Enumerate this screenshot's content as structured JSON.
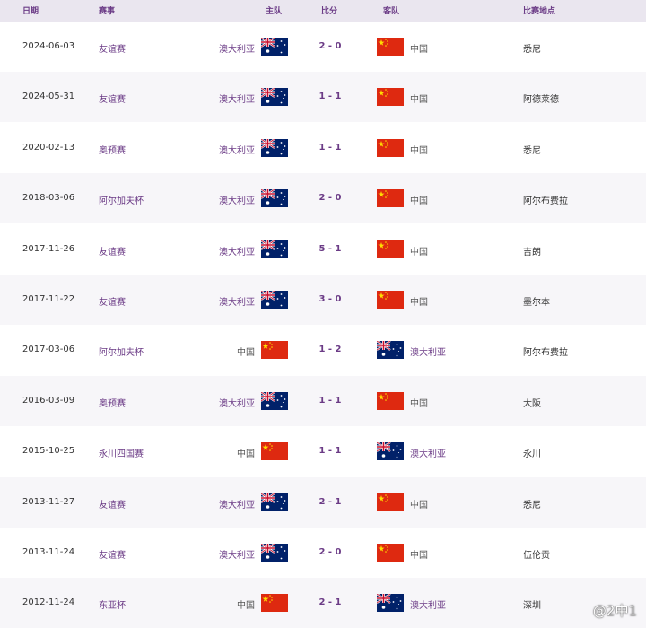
{
  "header": {
    "date": "日期",
    "competition": "赛事",
    "home": "主队",
    "score": "比分",
    "away": "客队",
    "venue": "比赛地点"
  },
  "flags": {
    "australia": "australia-flag-icon",
    "china": "china-flag-icon"
  },
  "colors": {
    "accent": "#6b3b86",
    "header_bg": "#eae6ef",
    "china_red": "#de2910",
    "china_star": "#ffde00",
    "aus_blue": "#012169"
  },
  "matches": [
    {
      "date": "2024-06-03",
      "competition": "友谊赛",
      "home": "澳大利亚",
      "home_team": "australia",
      "score": "2 - 0",
      "away": "中国",
      "away_team": "china",
      "venue": "悉尼"
    },
    {
      "date": "2024-05-31",
      "competition": "友谊赛",
      "home": "澳大利亚",
      "home_team": "australia",
      "score": "1 - 1",
      "away": "中国",
      "away_team": "china",
      "venue": "阿德莱德"
    },
    {
      "date": "2020-02-13",
      "competition": "奥预赛",
      "home": "澳大利亚",
      "home_team": "australia",
      "score": "1 - 1",
      "away": "中国",
      "away_team": "china",
      "venue": "悉尼"
    },
    {
      "date": "2018-03-06",
      "competition": "阿尔加夫杯",
      "home": "澳大利亚",
      "home_team": "australia",
      "score": "2 - 0",
      "away": "中国",
      "away_team": "china",
      "venue": "阿尔布费拉"
    },
    {
      "date": "2017-11-26",
      "competition": "友谊赛",
      "home": "澳大利亚",
      "home_team": "australia",
      "score": "5 - 1",
      "away": "中国",
      "away_team": "china",
      "venue": "吉朗"
    },
    {
      "date": "2017-11-22",
      "competition": "友谊赛",
      "home": "澳大利亚",
      "home_team": "australia",
      "score": "3 - 0",
      "away": "中国",
      "away_team": "china",
      "venue": "墨尔本"
    },
    {
      "date": "2017-03-06",
      "competition": "阿尔加夫杯",
      "home": "中国",
      "home_team": "china",
      "score": "1 - 2",
      "away": "澳大利亚",
      "away_team": "australia",
      "venue": "阿尔布费拉"
    },
    {
      "date": "2016-03-09",
      "competition": "奥预赛",
      "home": "澳大利亚",
      "home_team": "australia",
      "score": "1 - 1",
      "away": "中国",
      "away_team": "china",
      "venue": "大阪"
    },
    {
      "date": "2015-10-25",
      "competition": "永川四国赛",
      "home": "中国",
      "home_team": "china",
      "score": "1 - 1",
      "away": "澳大利亚",
      "away_team": "australia",
      "venue": "永川"
    },
    {
      "date": "2013-11-27",
      "competition": "友谊赛",
      "home": "澳大利亚",
      "home_team": "australia",
      "score": "2 - 1",
      "away": "中国",
      "away_team": "china",
      "venue": "悉尼"
    },
    {
      "date": "2013-11-24",
      "competition": "友谊赛",
      "home": "澳大利亚",
      "home_team": "australia",
      "score": "2 - 0",
      "away": "中国",
      "away_team": "china",
      "venue": "伍伦贡"
    },
    {
      "date": "2012-11-24",
      "competition": "东亚杯",
      "home": "中国",
      "home_team": "china",
      "score": "2 - 1",
      "away": "澳大利亚",
      "away_team": "australia",
      "venue": "深圳"
    }
  ],
  "watermark": "@2中1"
}
